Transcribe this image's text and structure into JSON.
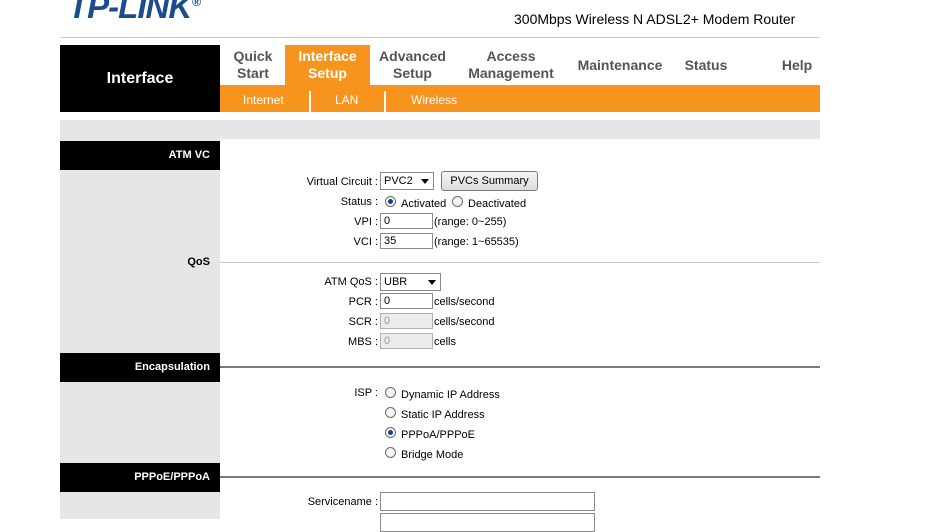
{
  "header": {
    "logo_text": "TP-LINK",
    "logo_reg": "®",
    "model": "300Mbps Wireless N ADSL2+ Modem Router"
  },
  "nav": {
    "section_title": "Interface",
    "tabs": [
      {
        "label": "Quick Start",
        "active": false
      },
      {
        "label": "Interface Setup",
        "active": true
      },
      {
        "label": "Advanced Setup",
        "active": false
      },
      {
        "label": "Access Management",
        "active": false
      },
      {
        "label": "Maintenance",
        "active": false
      },
      {
        "label": "Status",
        "active": false
      },
      {
        "label": "Help",
        "active": false
      }
    ],
    "subtabs": [
      "Internet",
      "LAN",
      "Wireless"
    ]
  },
  "sections": {
    "atm_vc": "ATM VC",
    "qos": "QoS",
    "encapsulation": "Encapsulation",
    "pppoe": "PPPoE/PPPoA"
  },
  "atm": {
    "virtual_circuit_label": "Virtual Circuit :",
    "virtual_circuit_value": "PVC2",
    "pvcs_summary_button": "PVCs Summary",
    "status_label": "Status :",
    "status_activated": "Activated",
    "status_deactivated": "Deactivated",
    "vpi_label": "VPI :",
    "vpi_value": "0",
    "vpi_range": "(range: 0~255)",
    "vci_label": "VCI :",
    "vci_value": "35",
    "vci_range": "(range: 1~65535)"
  },
  "qos": {
    "atm_qos_label": "ATM QoS :",
    "atm_qos_value": "UBR",
    "pcr_label": "PCR :",
    "pcr_value": "0",
    "pcr_unit": "cells/second",
    "scr_label": "SCR :",
    "scr_value": "0",
    "scr_unit": "cells/second",
    "mbs_label": "MBS :",
    "mbs_value": "0",
    "mbs_unit": "cells"
  },
  "encap": {
    "isp_label": "ISP :",
    "options": [
      {
        "label": "Dynamic IP Address",
        "selected": false
      },
      {
        "label": "Static IP Address",
        "selected": false
      },
      {
        "label": "PPPoA/PPPoE",
        "selected": true
      },
      {
        "label": "Bridge Mode",
        "selected": false
      }
    ]
  },
  "pppoe": {
    "servicename_label": "Servicename :",
    "servicename_value": ""
  },
  "colors": {
    "accent": "#f7941d",
    "logo": "#1a4c8f",
    "section_bg": "#e6e6e6"
  }
}
